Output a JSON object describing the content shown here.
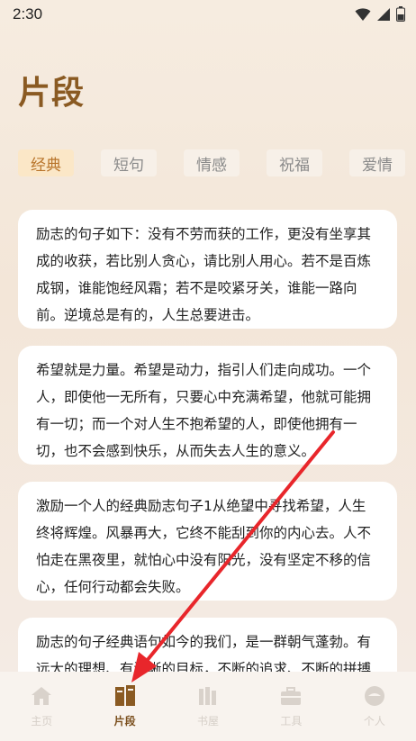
{
  "status": {
    "time": "2:30"
  },
  "title": "片段",
  "tabs": [
    {
      "label": "经典",
      "active": true
    },
    {
      "label": "短句",
      "active": false
    },
    {
      "label": "情感",
      "active": false
    },
    {
      "label": "祝福",
      "active": false
    },
    {
      "label": "爱情",
      "active": false
    }
  ],
  "cards": [
    {
      "text": "励志的句子如下：没有不劳而获的工作，更没有坐享其成的收获，若比别人贪心，请比别人用心。若不是百炼成钢，谁能饱经风霜；若不是咬紧牙关，谁能一路向前。逆境总是有的，人生总要进击。"
    },
    {
      "text": "希望就是力量。希望是动力，指引人们走向成功。一个人，即使他一无所有，只要心中充满希望，他就可能拥有一切；而一个对人生不抱希望的人，即使他拥有一切，也不会感到快乐，从而失去人生的意义。"
    },
    {
      "text": "激励一个人的经典励志句子1从绝望中寻找希望，人生终将辉煌。风暴再大，它终不能刮到你的内心去。人不怕走在黑夜里，就怕心中没有阳光，没有坚定不移的信心，任何行动都会失败。"
    },
    {
      "text": "励志的句子经典语句如今的我们，是一群朝气蓬勃。有远大的理想、有清晰的目标，不断的追求、不断的拼搏"
    }
  ],
  "nav": [
    {
      "label": "主页",
      "icon": "home-icon",
      "active": false
    },
    {
      "label": "片段",
      "icon": "book-icon",
      "active": true
    },
    {
      "label": "书屋",
      "icon": "bookshelf-icon",
      "active": false
    },
    {
      "label": "工具",
      "icon": "toolbox-icon",
      "active": false
    },
    {
      "label": "个人",
      "icon": "person-icon",
      "active": false
    }
  ],
  "colors": {
    "accent": "#8a5a22",
    "tab_active_bg": "#fbe7c7",
    "tab_active_text": "#b8742a",
    "arrow": "#e8262b"
  }
}
